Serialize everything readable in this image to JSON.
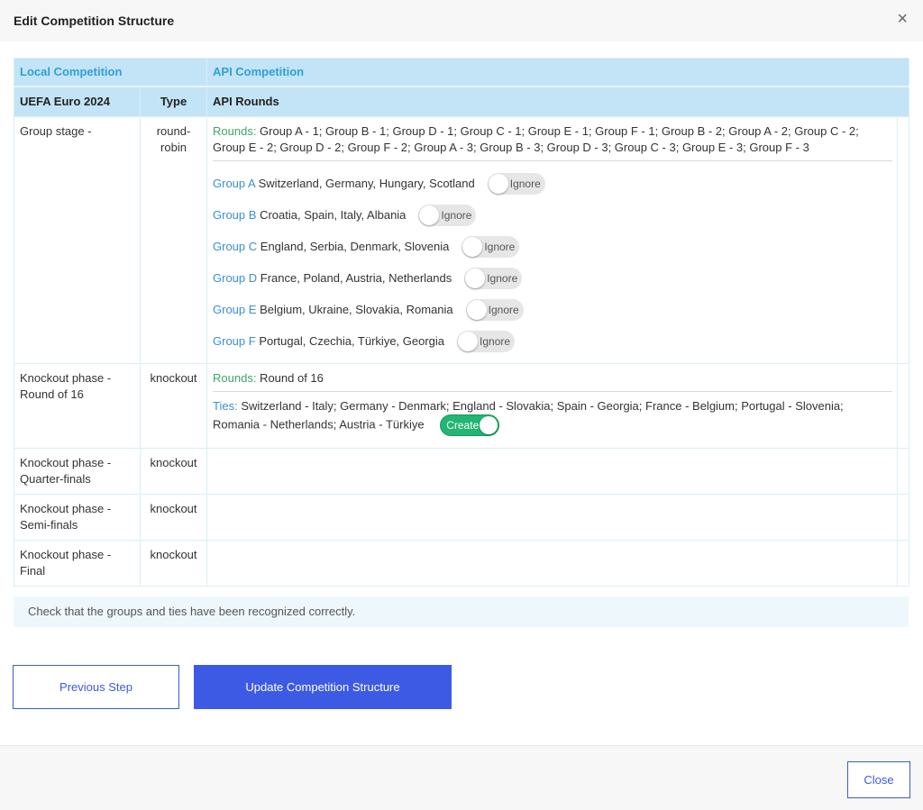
{
  "modal": {
    "title": "Edit Competition Structure",
    "close_icon": "×"
  },
  "table": {
    "header": {
      "local": "Local Competition",
      "api": "API Competition"
    },
    "subheader": {
      "competition": "UEFA Euro 2024",
      "type": "Type",
      "api_rounds": "API Rounds"
    },
    "group_stage": {
      "name": "Group stage -",
      "type": "round-robin",
      "rounds_label": "Rounds:",
      "rounds_value": " Group A - 1; Group B - 1; Group D - 1; Group C - 1; Group E - 1; Group F - 1; Group B - 2; Group A - 2; Group C - 2; Group E - 2; Group D - 2; Group F - 2; Group A - 3; Group B - 3; Group D - 3; Group C - 3; Group E - 3; Group F - 3",
      "groups": [
        {
          "name": "Group A",
          "teams": "Switzerland, Germany, Hungary, Scotland",
          "toggle": "Ignore"
        },
        {
          "name": "Group B",
          "teams": "Croatia, Spain, Italy, Albania",
          "toggle": "Ignore"
        },
        {
          "name": "Group C",
          "teams": "England, Serbia, Denmark, Slovenia",
          "toggle": "Ignore"
        },
        {
          "name": "Group D",
          "teams": "France, Poland, Austria, Netherlands",
          "toggle": "Ignore"
        },
        {
          "name": "Group E",
          "teams": "Belgium, Ukraine, Slovakia, Romania",
          "toggle": "Ignore"
        },
        {
          "name": "Group F",
          "teams": "Portugal, Czechia, Türkiye, Georgia",
          "toggle": "Ignore"
        }
      ]
    },
    "round16": {
      "name": "Knockout phase - Round of 16",
      "type": "knockout",
      "rounds_label": "Rounds:",
      "rounds_value": " Round of 16",
      "ties_label": "Ties:",
      "ties_value": " Switzerland - Italy; Germany - Denmark; England - Slovakia; Spain - Georgia; France - Belgium; Portugal - Slovenia; Romania - Netherlands; Austria - Türkiye",
      "toggle": "Create"
    },
    "quarter": {
      "name": "Knockout phase - Quarter-finals",
      "type": "knockout"
    },
    "semi": {
      "name": "Knockout phase - Semi-finals",
      "type": "knockout"
    },
    "final": {
      "name": "Knockout phase - Final",
      "type": "knockout"
    }
  },
  "info": "Check that the groups and ties have been recognized correctly.",
  "buttons": {
    "previous": "Previous Step",
    "update": "Update Competition Structure",
    "close": "Close"
  },
  "colors": {
    "primary": "#3d5ae4",
    "header_bg": "#c3e4f6",
    "toggle_on": "#22b573"
  }
}
